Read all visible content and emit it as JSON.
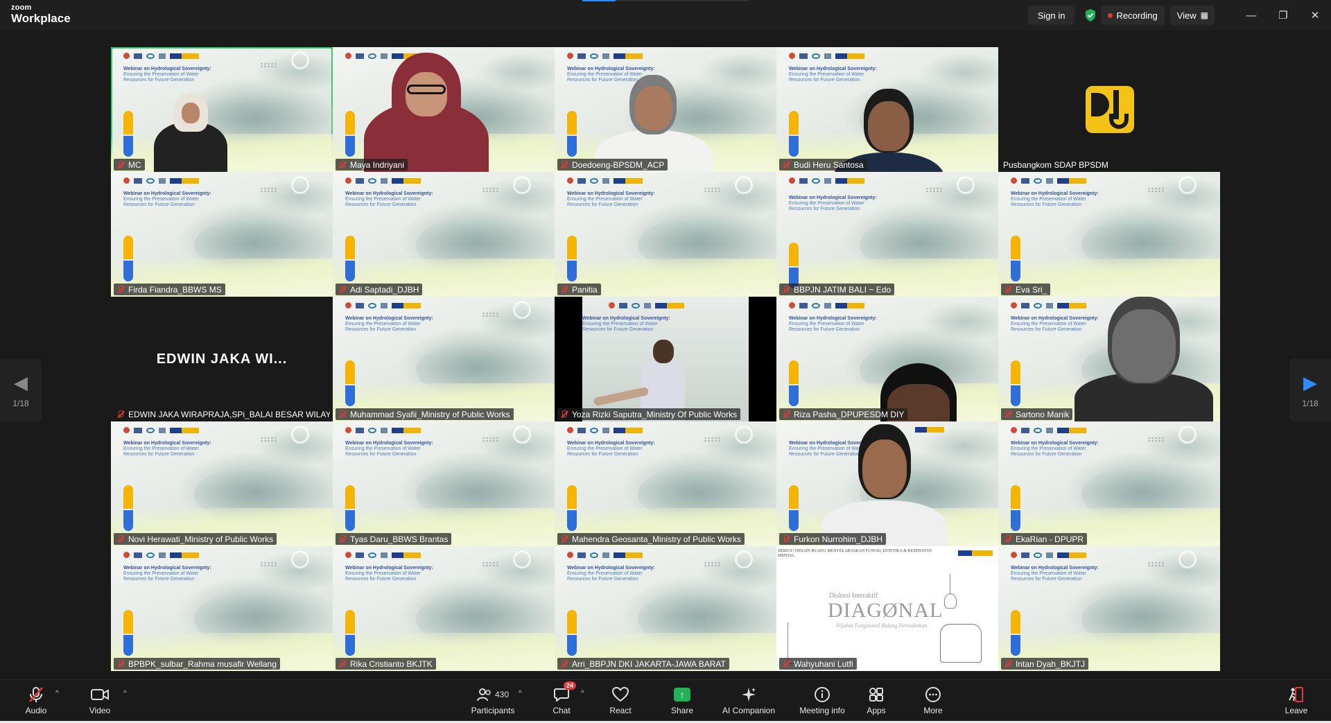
{
  "app": {
    "logo_top": "zoom",
    "logo_bottom": "Workplace"
  },
  "topbar": {
    "signin": "Sign in",
    "recording": "Recording",
    "view": "View"
  },
  "slide": {
    "title": "Webinar on Hydrological Sovereignty:",
    "subtitle_line1": "Ensuring the Preservation of Water",
    "subtitle_line2": "Resources for Future Generation"
  },
  "tiles": [
    {
      "name": "MC"
    },
    {
      "name": "Maya Indriyani"
    },
    {
      "name": "Doedoeng-BPSDM_ACP"
    },
    {
      "name": "Budi Heru Santosa"
    },
    {
      "name": "Pusbangkom SDAP BPSDM"
    },
    {
      "name": "Firda Fiandra_BBWS MS"
    },
    {
      "name": "Adi Saptadi_DJBH"
    },
    {
      "name": "Panitia"
    },
    {
      "name": "BBPJN JATIM BALI ~ Edo"
    },
    {
      "name": "Eva Sri_"
    },
    {
      "name": "EDWIN JAKA WIRAPRAJA,SPi_BALAI BESAR WILAY...",
      "big": "EDWIN JAKA WI..."
    },
    {
      "name": "Muhammad Syafii_Ministry of Public Works"
    },
    {
      "name": "Yoza Rizki Saputra_Ministry Of Public Works"
    },
    {
      "name": "Riza Pasha_DPUPESDM DIY"
    },
    {
      "name": "Sartono Manik"
    },
    {
      "name": "Novi Herawati_Ministry of Public Works"
    },
    {
      "name": "Tyas Daru_BBWS Brantas"
    },
    {
      "name": "Mahendra Geosanta_Ministry of Public Works"
    },
    {
      "name": "Furkon Nurrohim_DJBH"
    },
    {
      "name": "EkaRian - DPUPR"
    },
    {
      "name": "BPBPK_sulbar_Rahma musafir Wellang"
    },
    {
      "name": "Rika Cristianto BKJTK"
    },
    {
      "name": "Arri_BBPJN DKI JAKARTA-JAWA BARAT"
    },
    {
      "name": "Wahyuhani Lutfi"
    },
    {
      "name": "Intan Dyah_BKJTJ"
    }
  ],
  "diagonal": {
    "header": "SERIUS | DESAIN RUANG MENYELARASKAN FUNGSI, ESTETIKA & KESEHATAN MENTAL",
    "small": "Diskusi Interaktif",
    "title": "DIAGØNAL",
    "caption": "Pejabat Fungsional Bidang Permukiman"
  },
  "pagination": {
    "left": "1/18",
    "right": "1/18"
  },
  "toolbar": {
    "audio": "Audio",
    "video": "Video",
    "participants": "Participants",
    "participants_count": "430",
    "chat": "Chat",
    "chat_badge": "24",
    "react": "React",
    "share": "Share",
    "ai": "AI Companion",
    "meeting_info": "Meeting info",
    "apps": "Apps",
    "more": "More",
    "leave": "Leave"
  },
  "colors": {
    "accent": "#2d8cff",
    "active_speaker": "#2ecc71",
    "muted": "#e03a3a",
    "share": "#23b25a"
  }
}
